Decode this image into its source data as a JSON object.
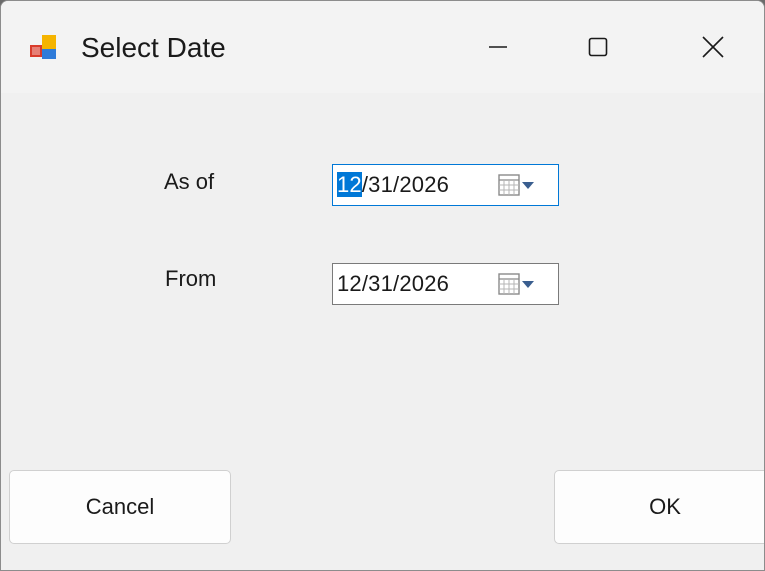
{
  "window": {
    "title": "Select Date",
    "icon": "form-app-icon",
    "controls": {
      "minimize_icon": "minimize-icon",
      "maximize_icon": "maximize-icon",
      "close_icon": "close-icon"
    }
  },
  "fields": [
    {
      "label": "As of",
      "date_selected_segment": "12",
      "date_rest": "/31/2026",
      "value": "12/31/2026",
      "focused": true,
      "button_icon": "calendar-dropdown-icon"
    },
    {
      "label": "From",
      "value": "12/31/2026",
      "focused": false,
      "button_icon": "calendar-dropdown-icon"
    }
  ],
  "buttons": {
    "cancel_label": "Cancel",
    "ok_label": "OK"
  },
  "colors": {
    "selection": "#0078d7",
    "focus_border": "#0078d7",
    "dialog_background": "#f0f0f0"
  }
}
